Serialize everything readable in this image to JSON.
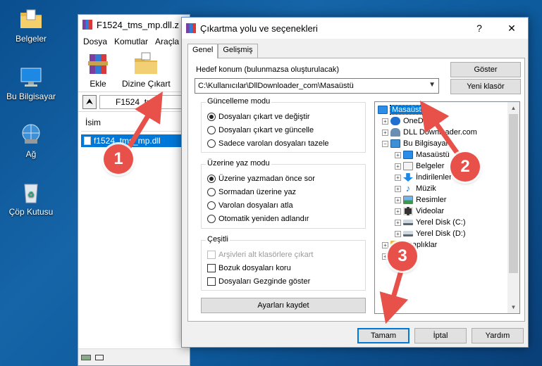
{
  "desktop": {
    "icons": [
      {
        "label": "Belgeler",
        "icon": "folder-documents-icon"
      },
      {
        "label": "Bu Bilgisayar",
        "icon": "computer-icon"
      },
      {
        "label": "Ağ",
        "icon": "network-icon"
      },
      {
        "label": "Çöp Kutusu",
        "icon": "recycle-bin-icon"
      }
    ]
  },
  "winrar": {
    "title": "F1524_tms_mp.dll.z",
    "menu": [
      "Dosya",
      "Komutlar",
      "Araçla"
    ],
    "toolbar": {
      "add_label": "Ekle",
      "extract_label": "Dizine Çıkart"
    },
    "path": "F1524_tms",
    "column_name": "İsim",
    "file_name": "f1524_tms_mp.dll"
  },
  "dialog": {
    "title": "Çıkartma yolu ve seçenekleri",
    "help_btn": "?",
    "close_btn": "✕",
    "tabs": [
      "Genel",
      "Gelişmiş"
    ],
    "dest_label": "Hedef konum (bulunmazsa oluşturulacak)",
    "dest_value": "C:\\Kullanıcılar\\DllDownloader_com\\Masaüstü",
    "show_btn": "Göster",
    "new_folder_btn": "Yeni klasör",
    "update_mode": {
      "title": "Güncelleme modu",
      "options": [
        "Dosyaları çıkart ve değiştir",
        "Dosyaları çıkart ve güncelle",
        "Sadece varolan dosyaları tazele"
      ],
      "selected": 0
    },
    "overwrite_mode": {
      "title": "Üzerine yaz modu",
      "options": [
        "Üzerine yazmadan önce sor",
        "Sormadan üzerine yaz",
        "Varolan dosyaları atla",
        "Otomatik yeniden adlandır"
      ],
      "selected": 0
    },
    "misc": {
      "title": "Çeşitli",
      "options": [
        "Arşivleri alt klasörlere çıkart",
        "Bozuk dosyaları koru",
        "Dosyaları Gezginde göster"
      ]
    },
    "save_settings_btn": "Ayarları kaydet",
    "tree": [
      {
        "label": "Masaüstü",
        "icon": "desktop-icon",
        "selected": true
      },
      {
        "label": "OneDrive",
        "icon": "onedrive-icon"
      },
      {
        "label": "DLL Downloader.com",
        "icon": "user-icon"
      },
      {
        "label": "Bu Bilgisayar",
        "icon": "computer-icon"
      },
      {
        "label": "Masaüstü",
        "icon": "desktop-icon"
      },
      {
        "label": "Belgeler",
        "icon": "documents-icon"
      },
      {
        "label": "İndirilenler",
        "icon": "downloads-icon"
      },
      {
        "label": "Müzik",
        "icon": "music-icon"
      },
      {
        "label": "Resimler",
        "icon": "pictures-icon"
      },
      {
        "label": "Videolar",
        "icon": "videos-icon"
      },
      {
        "label": "Yerel Disk (C:)",
        "icon": "drive-icon"
      },
      {
        "label": "Yerel Disk (D:)",
        "icon": "drive-icon"
      },
      {
        "label": "Kitaplıklar",
        "icon": "libraries-icon"
      },
      {
        "label": "Ağ",
        "icon": "network-icon"
      }
    ],
    "ok_btn": "Tamam",
    "cancel_btn": "İptal",
    "help_text_btn": "Yardım"
  },
  "markers": [
    "1",
    "2",
    "3"
  ],
  "colors": {
    "marker": "#e8504a",
    "selection": "#0078d7"
  }
}
